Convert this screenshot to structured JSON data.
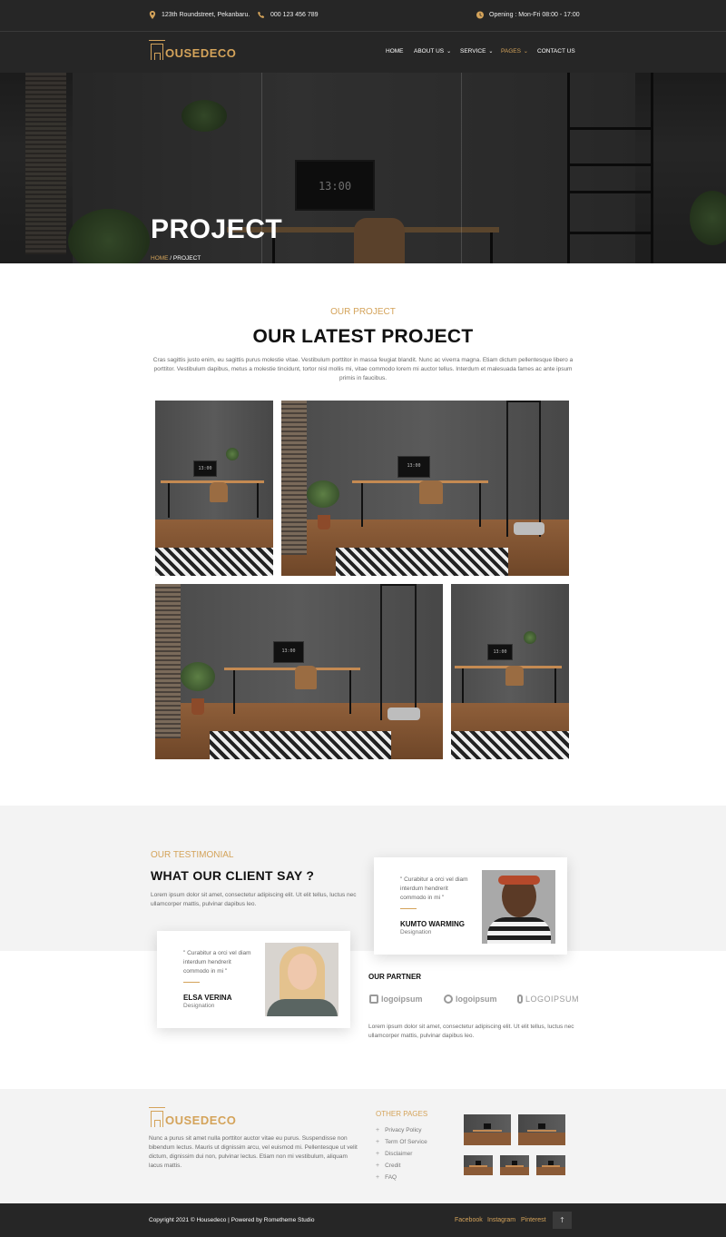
{
  "topbar": {
    "address": "123th Roundstreet, Pekanbaru.",
    "phone": "000 123 456 789",
    "opening": "Opening : Mon-Fri 08:00 - 17:00"
  },
  "brand": {
    "name": "OUSEDECO",
    "accent": "#d4a35a",
    "dark": "#262626"
  },
  "nav": {
    "items": [
      {
        "label": "HOME",
        "dropdown": false
      },
      {
        "label": "ABOUT US",
        "dropdown": true
      },
      {
        "label": "SERVICE",
        "dropdown": true
      },
      {
        "label": "PAGES",
        "dropdown": true,
        "active": true
      },
      {
        "label": "CONTACT US",
        "dropdown": false
      }
    ]
  },
  "hero": {
    "title": "PROJECT",
    "clock": "13:00",
    "breadcrumb": {
      "home": "HOME",
      "separator": " / ",
      "current": "PROJECT"
    }
  },
  "project": {
    "eyebrow": "OUR PROJECT",
    "title": "OUR LATEST PROJECT",
    "description": "Cras sagittis justo enim, eu sagittis purus molestie vitae. Vestibulum porttitor in massa feugiat blandit. Nunc ac viverra magna. Etiam dictum pellentesque libero a porttitor. Vestibulum dapibus, metus a molestie tincidunt, tortor nisl mollis mi, vitae commodo lorem mi auctor tellus. Interdum et malesuada fames ac ante ipsum primis in faucibus.",
    "photo_clock": "13:00"
  },
  "testimonial": {
    "eyebrow": "OUR TESTIMONIAL",
    "title": "WHAT OUR CLIENT SAY ?",
    "description": "Lorem ipsum dolor sit amet, consectetur adipiscing elit. Ut elit tellus, luctus nec ullamcorper mattis, pulvinar dapibus leo.",
    "cards": [
      {
        "quote": "\" Curabitur a orci vel diam interdum hendrerit commodo in mi \"",
        "name": "KUMTO WARMING",
        "designation": "Designation"
      },
      {
        "quote": "\" Curabitur a orci vel diam interdum hendrerit commodo in mi \"",
        "name": "ELSA VERINA",
        "designation": "Designation"
      }
    ]
  },
  "partner": {
    "title": "OUR PARTNER",
    "logos": [
      "logoipsum",
      "logoipsum",
      "LOGOIPSUM"
    ],
    "description": "Lorem ipsum dolor sit amet, consectetur adipiscing elit. Ut elit tellus, luctus nec ullamcorper mattis, pulvinar dapibus leo."
  },
  "footer": {
    "brand": "OUSEDECO",
    "about": "Nunc a purus sit amet nulla porttitor auctor vitae eu purus. Suspendisse non bibendum lectus. Mauris ut dignissim arcu, vel euismod mi. Pellentesque ut velit dictum, dignissim dui non, pulvinar lectus. Etiam non mi vestibulum, aliquam lacus mattis.",
    "other_pages_title": "OTHER PAGES",
    "other_pages": [
      "Privacy Policy",
      "Term Of Service",
      "Disclaimer",
      "Credit",
      "FAQ"
    ],
    "copyright": "Copyright 2021 © Housedeco | Powered by Rometheme Studio",
    "social": [
      "Facebook",
      "Instagram",
      "Pinterest"
    ],
    "totop_icon": "arrow-up-icon"
  }
}
